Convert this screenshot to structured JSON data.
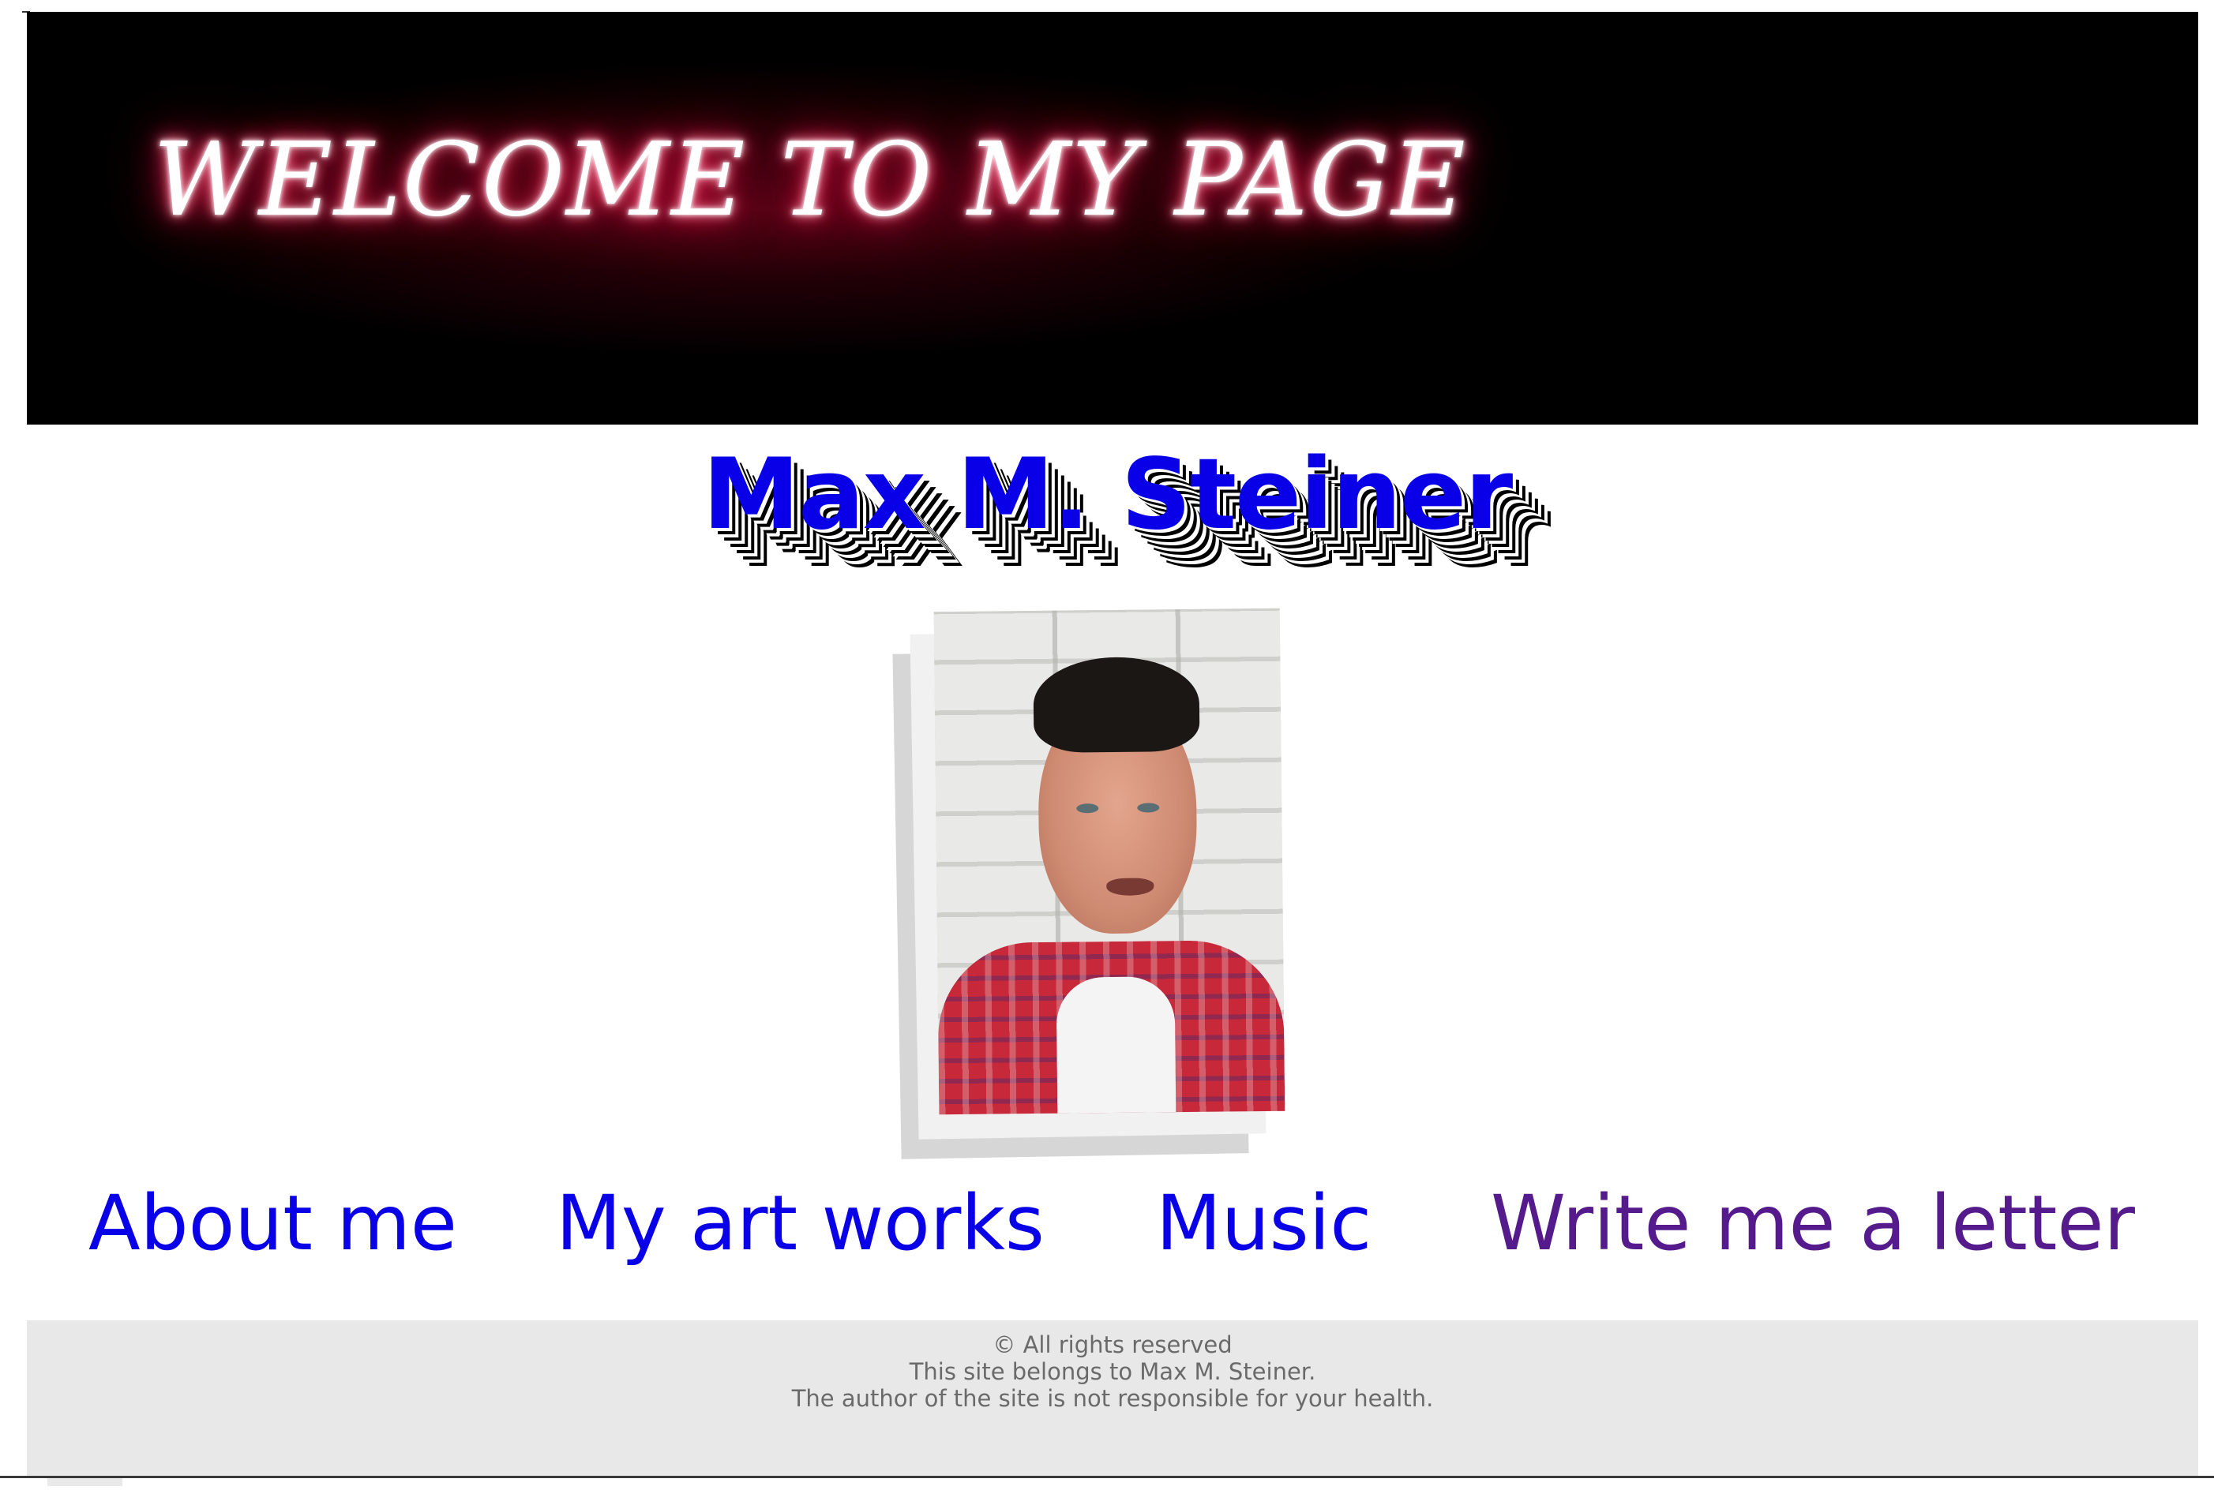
{
  "header": {
    "banner_title": "WELCOME TO MY PAGE"
  },
  "profile": {
    "name": "Max M. Steiner",
    "photo_icon": "portrait-photo"
  },
  "nav": {
    "items": [
      {
        "label": "About me"
      },
      {
        "label": "My art works"
      },
      {
        "label": "Music"
      },
      {
        "label": "Write me a letter"
      }
    ],
    "link_color": "#0a00e8",
    "visited_color": "#551a8b"
  },
  "footer": {
    "line1": "© All rights reserved",
    "line2": "This site belongs to Max M. Steiner.",
    "line3": "The author of the site is not responsible for your health."
  },
  "colors": {
    "banner_bg": "#000000",
    "glow": "#ff2a5c",
    "footer_bg": "#e8e8e8"
  }
}
